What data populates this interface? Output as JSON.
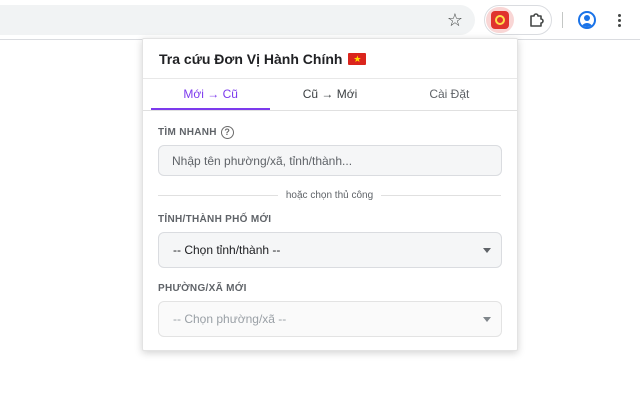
{
  "popup": {
    "title": "Tra cứu Đơn Vị Hành Chính",
    "tabs": [
      {
        "label": "Mới → Cũ",
        "active": true
      },
      {
        "label": "Cũ → Mới",
        "active": false
      },
      {
        "label": "Cài Đặt",
        "active": false
      }
    ],
    "quick_search": {
      "label": "TÌM NHANH",
      "placeholder": "Nhập tên phường/xã, tỉnh/thành..."
    },
    "divider_text": "hoặc chọn thủ công",
    "province": {
      "label": "TỈNH/THÀNH PHỐ MỚI",
      "selected": "-- Chọn tỉnh/thành --"
    },
    "ward": {
      "label": "PHƯỜNG/XÃ MỚI",
      "selected": "-- Chọn phường/xã --",
      "disabled": true
    }
  },
  "colors": {
    "accent": "#7c3aed",
    "extension_red": "#e0332e"
  },
  "icons": [
    "star-icon",
    "extension-logo-icon",
    "puzzle-icon",
    "profile-icon",
    "more-menu-icon",
    "vietnam-flag-icon",
    "help-icon",
    "chevron-down-icon"
  ]
}
